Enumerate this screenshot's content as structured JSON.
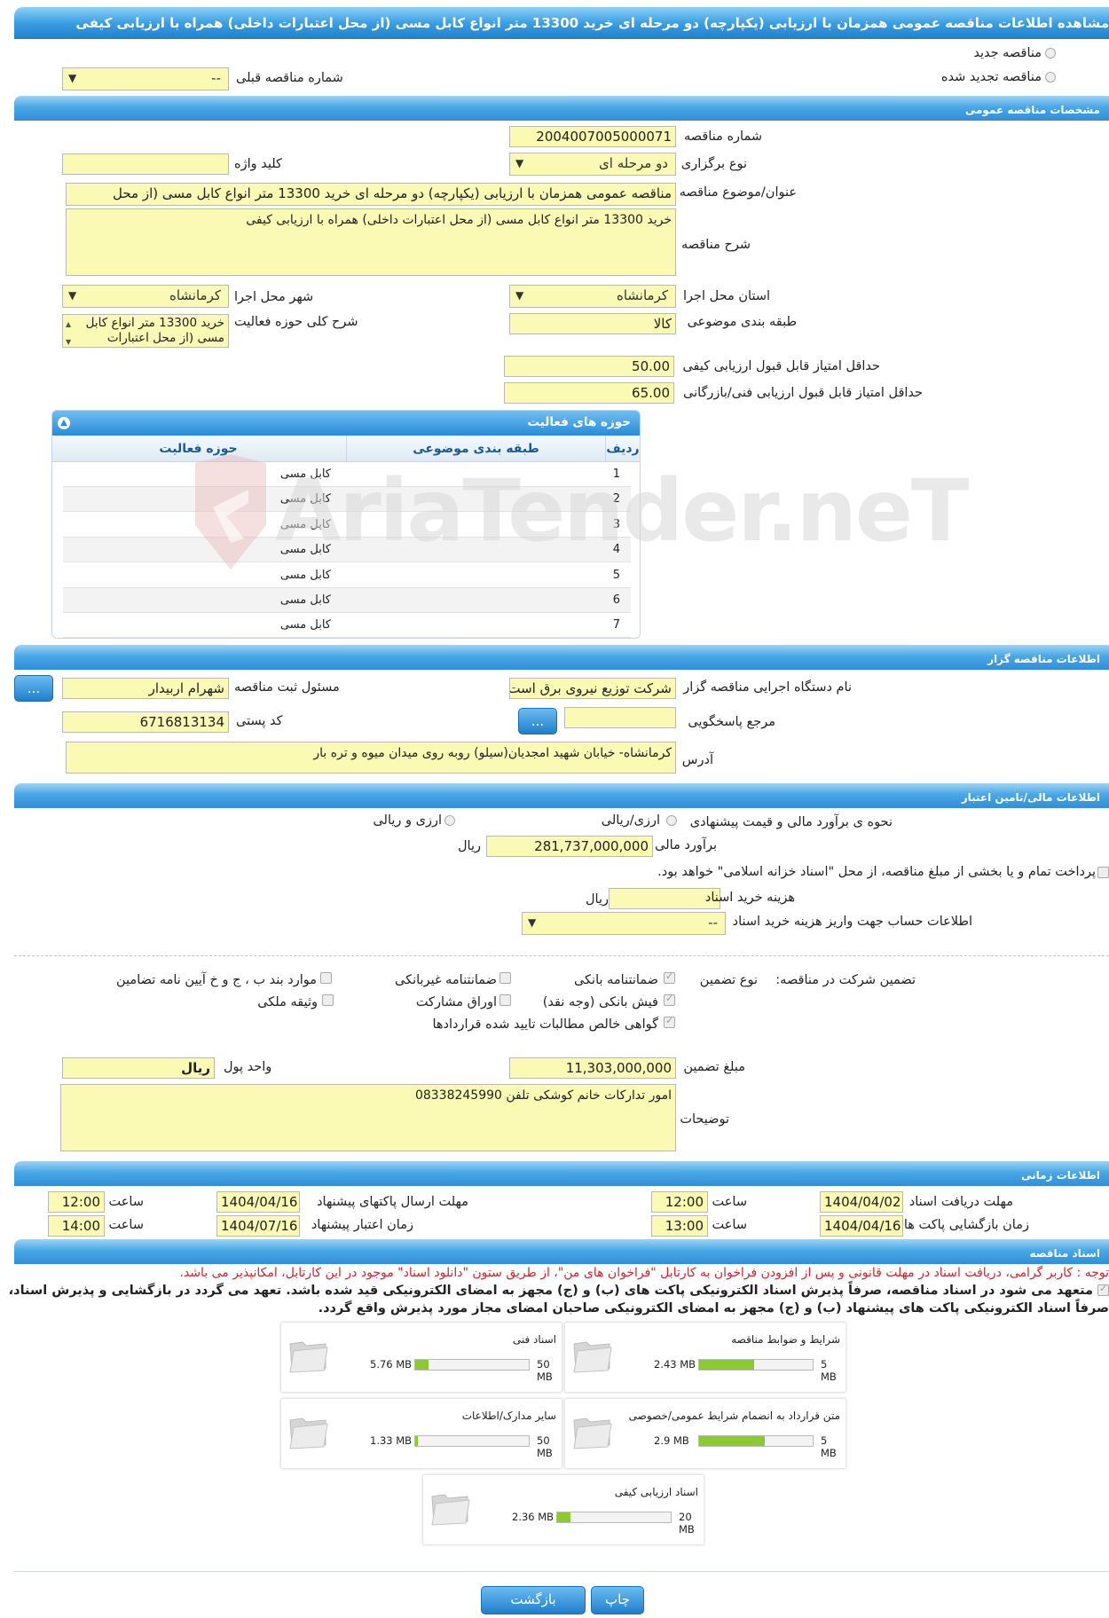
{
  "header": {
    "title": "مشاهده اطلاعات مناقصه عمومی همزمان با ارزیابی (یکپارچه) دو مرحله ای خرید 13300 متر انواع کابل مسی (از محل اعتبارات داخلی) همراه با ارزیابی کیفی"
  },
  "tender_type": {
    "new_label": "مناقصه جدید",
    "renewed_label": "مناقصه تجدید شده",
    "prev_number_label": "شماره مناقصه قبلی",
    "prev_number_value": "--"
  },
  "general": {
    "section_title": "مشخصات مناقصه عمومی",
    "number_label": "شماره مناقصه",
    "number_value": "2004007005000071",
    "holding_type_label": "نوع برگزاری",
    "holding_type_value": "دو مرحله ای",
    "keyword_label": "کلید واژه",
    "keyword_value": "",
    "subject_label": "عنوان/موضوع مناقصه",
    "subject_value": "مناقصه عمومی همزمان با ارزیابی (یکپارچه) دو مرحله ای خرید 13300 متر انواع کابل مسی (از محل",
    "description_label": "شرح مناقصه",
    "description_value": "خرید 13300 متر انواع کابل مسی (از محل اعتبارات داخلی) همراه با ارزیابی کیفی",
    "province_label": "استان محل اجرا",
    "province_value": "کرمانشاه",
    "city_label": "شهر محل اجرا",
    "city_value": "کرمانشاه",
    "category_label": "طبقه بندی موضوعی",
    "category_value": "کالا",
    "activity_desc_label": "شرح کلی حوزه فعالیت",
    "activity_desc_value": "خرید 13300 متر انواع کابل مسی (از محل اعتبارات",
    "min_quality_label": "حداقل امتیاز قابل قبول ارزیابی کیفی",
    "min_quality_value": "50.00",
    "min_tech_label": "حداقل امتیاز قابل قبول ارزیابی فنی/بازرگانی",
    "min_tech_value": "65.00"
  },
  "activity_grid": {
    "title": "حوزه های فعالیت",
    "col_row": "ردیف",
    "col_category": "طبقه بندی موضوعی",
    "col_field": "حوزه فعالیت",
    "rows": [
      {
        "n": "1",
        "category": "",
        "field": "کابل مسی"
      },
      {
        "n": "2",
        "category": "",
        "field": "کابل مسی"
      },
      {
        "n": "3",
        "category": "",
        "field": "کابل مسی"
      },
      {
        "n": "4",
        "category": "",
        "field": "کابل مسی"
      },
      {
        "n": "5",
        "category": "",
        "field": "کابل مسی"
      },
      {
        "n": "6",
        "category": "",
        "field": "کابل مسی"
      },
      {
        "n": "7",
        "category": "",
        "field": "کابل مسی"
      }
    ]
  },
  "watermark": "AriaTender.neT",
  "organizer": {
    "section_title": "اطلاعات مناقصه گزار",
    "org_label": "نام دستگاه اجرایی مناقصه گزار",
    "org_value": "شرکت توزیع نیروی برق است",
    "responsible_label": "مسئول ثبت مناقصه",
    "responsible_value": "شهرام اربیدار",
    "reference_label": "مرجع پاسخگویی",
    "reference_value": "",
    "postal_label": "کد پستی",
    "postal_value": "6716813134",
    "address_label": "آدرس",
    "address_value": "کرمانشاه- خیابان شهید امجدیان(سیلو) روبه روی میدان میوه و تره بار",
    "more_button": "..."
  },
  "finance": {
    "section_title": "اطلاعات مالی/تامین اعتبار",
    "estimate_method_label": "نحوه ی برآورد مالی و قیمت پیشنهادی",
    "option_rial": "ارزی/ریالی",
    "option_both": "ارزی و ریالی",
    "estimate_label": "برآورد مالی",
    "estimate_value": "281,737,000,000",
    "currency": "ریال",
    "treasury_label": "پرداخت تمام و یا بخشی از مبلغ مناقصه، از محل \"اسناد خزانه اسلامی\" خواهد بود.",
    "doc_fee_label": "هزینه خرید اسناد",
    "doc_fee_value": "",
    "doc_fee_unit": "ریال",
    "account_label": "اطلاعات حساب جهت واریز هزینه خرید اسناد",
    "account_value": "--"
  },
  "guarantee": {
    "label": "تضمین شرکت در مناقصه:",
    "type_label": "نوع تضمین",
    "options": {
      "bank_guarantee": "ضمانتنامه بانکی",
      "non_bank_guarantee": "ضمانتنامه غیربانکی",
      "clauses": "موارد بند ب ، ج و خ آیین نامه تضامین",
      "bank_receipt": "فیش بانکی (وجه نقد)",
      "participation_bonds": "اوراق مشارکت",
      "property": "وثیقه ملکی",
      "net_claims": "گواهی خالص مطالبات تایید شده قراردادها"
    },
    "amount_label": "مبلغ تضمین",
    "amount_value": "11,303,000,000",
    "unit_label": "واحد پول",
    "unit_value": "ریال",
    "notes_label": "توضیحات",
    "notes_value": "امور تدارکات خانم کوشکی تلفن 08338245990"
  },
  "timing": {
    "section_title": "اطلاعات زمانی",
    "doc_deadline_label": "مهلت دریافت اسناد",
    "doc_deadline_date": "1404/04/02",
    "doc_deadline_time": "12:00",
    "submit_deadline_label": "مهلت ارسال پاکتهای پیشنهاد",
    "submit_deadline_date": "1404/04/16",
    "submit_deadline_time": "12:00",
    "opening_label": "زمان بازگشایی پاکت ها",
    "opening_date": "1404/04/16",
    "opening_time": "13:00",
    "validity_label": "زمان اعتبار پیشنهاد",
    "validity_date": "1404/07/16",
    "validity_time": "14:00",
    "time_label": "ساعت"
  },
  "documents": {
    "section_title": "اسناد مناقصه",
    "notice_red": "توجه : کاربر گرامی، دریافت اسناد در مهلت قانونی و پس از افزودن فراخوان به کارتابل \"فراخوان های من\"، از طریق ستون \"دانلود اسناد\" موجود در این کارتابل، امکانپذیر می باشد.",
    "commit_line1": "متعهد می شود در اسناد مناقصه، صرفاً پذیرش اسناد الکترونیکی پاکت های (ب) و (ج) مجهز به امضای الکترونیکی قید شده باشد. تعهد می گردد در بازگشایی و پذیرش اسناد،",
    "commit_line2": "صرفاً اسناد الکترونیکی پاکت های پیشنهاد (ب) و (ج) مجهز به امضای الکترونیکی صاحبان امضای مجاز مورد پذیرش واقع گردد.",
    "files": [
      {
        "name": "شرایط و ضوابط مناقصه",
        "used": "2.43 MB",
        "max": "5 MB",
        "fraction": 0.486
      },
      {
        "name": "اسناد فنی",
        "used": "5.76 MB",
        "max": "50 MB",
        "fraction": 0.115
      },
      {
        "name": "متن قرارداد به انضمام شرایط عمومی/خصوصی",
        "used": "2.9 MB",
        "max": "5 MB",
        "fraction": 0.58
      },
      {
        "name": "سایر مدارک/اطلاعات",
        "used": "1.33 MB",
        "max": "50 MB",
        "fraction": 0.027
      },
      {
        "name": "اسناد ارزیابی کیفی",
        "used": "2.36 MB",
        "max": "20 MB",
        "fraction": 0.118
      }
    ]
  },
  "footer": {
    "print_label": "چاپ",
    "back_label": "بازگشت"
  }
}
